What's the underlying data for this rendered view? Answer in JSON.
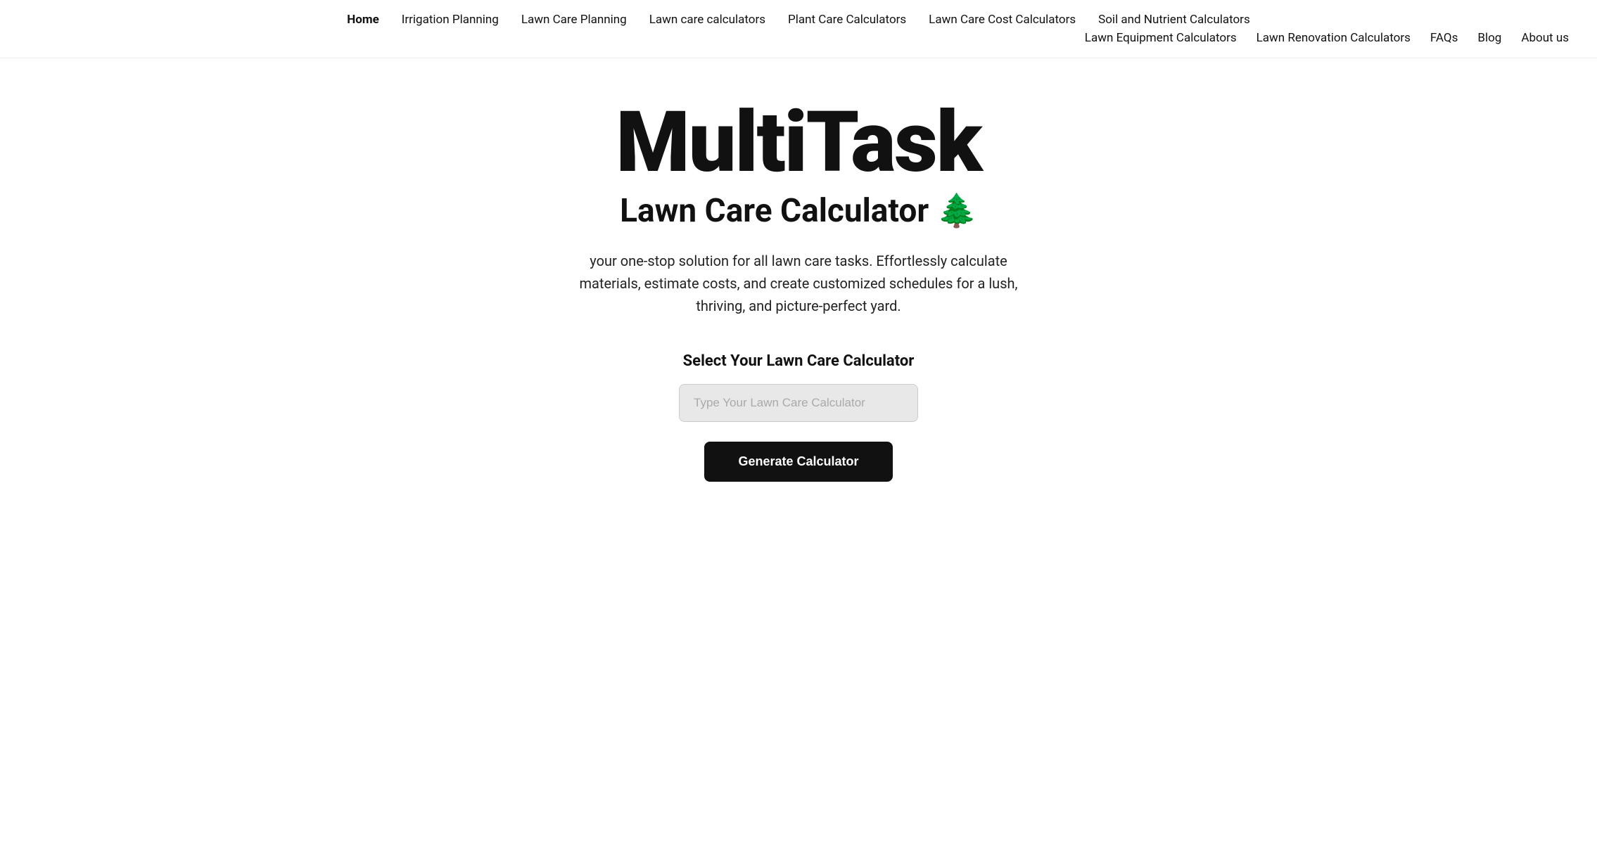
{
  "nav": {
    "row1": [
      {
        "id": "home",
        "label": "Home",
        "active": true
      },
      {
        "id": "irrigation-planning",
        "label": "Irrigation Planning",
        "active": false
      },
      {
        "id": "lawn-care-planning",
        "label": "Lawn Care Planning",
        "active": false
      },
      {
        "id": "lawn-care-calculators",
        "label": "Lawn care calculators",
        "active": false
      },
      {
        "id": "plant-care-calculators",
        "label": "Plant Care Calculators",
        "active": false
      },
      {
        "id": "lawn-care-cost-calculators",
        "label": "Lawn Care Cost Calculators",
        "active": false
      },
      {
        "id": "soil-and-nutrient-calculators",
        "label": "Soil and Nutrient Calculators",
        "active": false
      }
    ],
    "row2": [
      {
        "id": "lawn-equipment-calculators",
        "label": "Lawn Equipment Calculators",
        "active": false
      },
      {
        "id": "lawn-renovation-calculators",
        "label": "Lawn Renovation Calculators",
        "active": false
      },
      {
        "id": "faqs",
        "label": "FAQs",
        "active": false
      },
      {
        "id": "blog",
        "label": "Blog",
        "active": false
      },
      {
        "id": "about-us",
        "label": "About us",
        "active": false
      }
    ]
  },
  "hero": {
    "title": "MultiTask",
    "subtitle": "Lawn Care Calculator 🌲",
    "description": "your one-stop solution for all lawn care tasks. Effortlessly calculate materials, estimate costs, and create customized schedules for a lush, thriving, and picture-perfect yard."
  },
  "calculator": {
    "label": "Select Your Lawn Care Calculator",
    "input_placeholder": "Type Your Lawn Care Calculator",
    "button_label": "Generate Calculator"
  }
}
